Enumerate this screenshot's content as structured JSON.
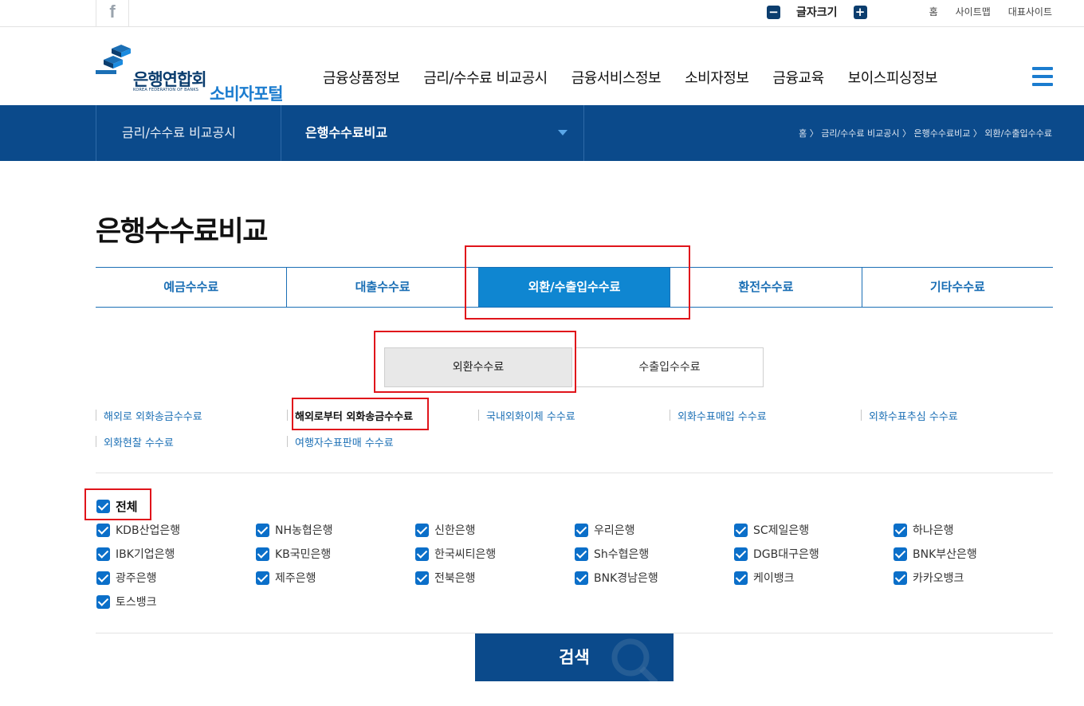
{
  "top": {
    "facebook_icon": "f",
    "font_size_label": "글자크기",
    "font_minus": "−",
    "font_plus": "+",
    "links": [
      "홈",
      "사이트맵",
      "대표사이트"
    ]
  },
  "header": {
    "logo_main": "은행연합회",
    "logo_sub": "KOREA FEDERATION OF BANKS",
    "logo_portal": "소비자포털",
    "nav": [
      "금융상품정보",
      "금리/수수료 비교공시",
      "금융서비스정보",
      "소비자정보",
      "금융교육",
      "보이스피싱정보"
    ]
  },
  "subbar": {
    "section": "금리/수수료 비교공시",
    "current": "은행수수료비교",
    "breadcrumb": "홈 〉 금리/수수료 비교공시 〉 은행수수료비교 〉 외환/수출입수수료"
  },
  "page_title": "은행수수료비교",
  "tabs": [
    {
      "label": "예금수수료",
      "active": false
    },
    {
      "label": "대출수수료",
      "active": false
    },
    {
      "label": "외환/수출입수수료",
      "active": true
    },
    {
      "label": "환전수수료",
      "active": false
    },
    {
      "label": "기타수수료",
      "active": false
    }
  ],
  "toggles": {
    "fx": "외환수수료",
    "trade": "수출입수수료"
  },
  "sublinks": [
    "해외로 외화송금수수료",
    "해외로부터 외화송금수수료",
    "국내외화이체 수수료",
    "외화수표매입 수수료",
    "외화수표추심 수수료",
    "외화현찰 수수료",
    "여행자수표판매 수수료"
  ],
  "check_all": "전체",
  "banks": [
    "KDB산업은행",
    "NH농협은행",
    "신한은행",
    "우리은행",
    "SC제일은행",
    "하나은행",
    "IBK기업은행",
    "KB국민은행",
    "한국씨티은행",
    "Sh수협은행",
    "DGB대구은행",
    "BNK부산은행",
    "광주은행",
    "제주은행",
    "전북은행",
    "BNK경남은행",
    "케이뱅크",
    "카카오뱅크",
    "토스뱅크"
  ],
  "search_label": "검색",
  "colors": {
    "navy": "#0b4a8b",
    "accent": "#0f86d1",
    "highlight": "#e0141b"
  }
}
